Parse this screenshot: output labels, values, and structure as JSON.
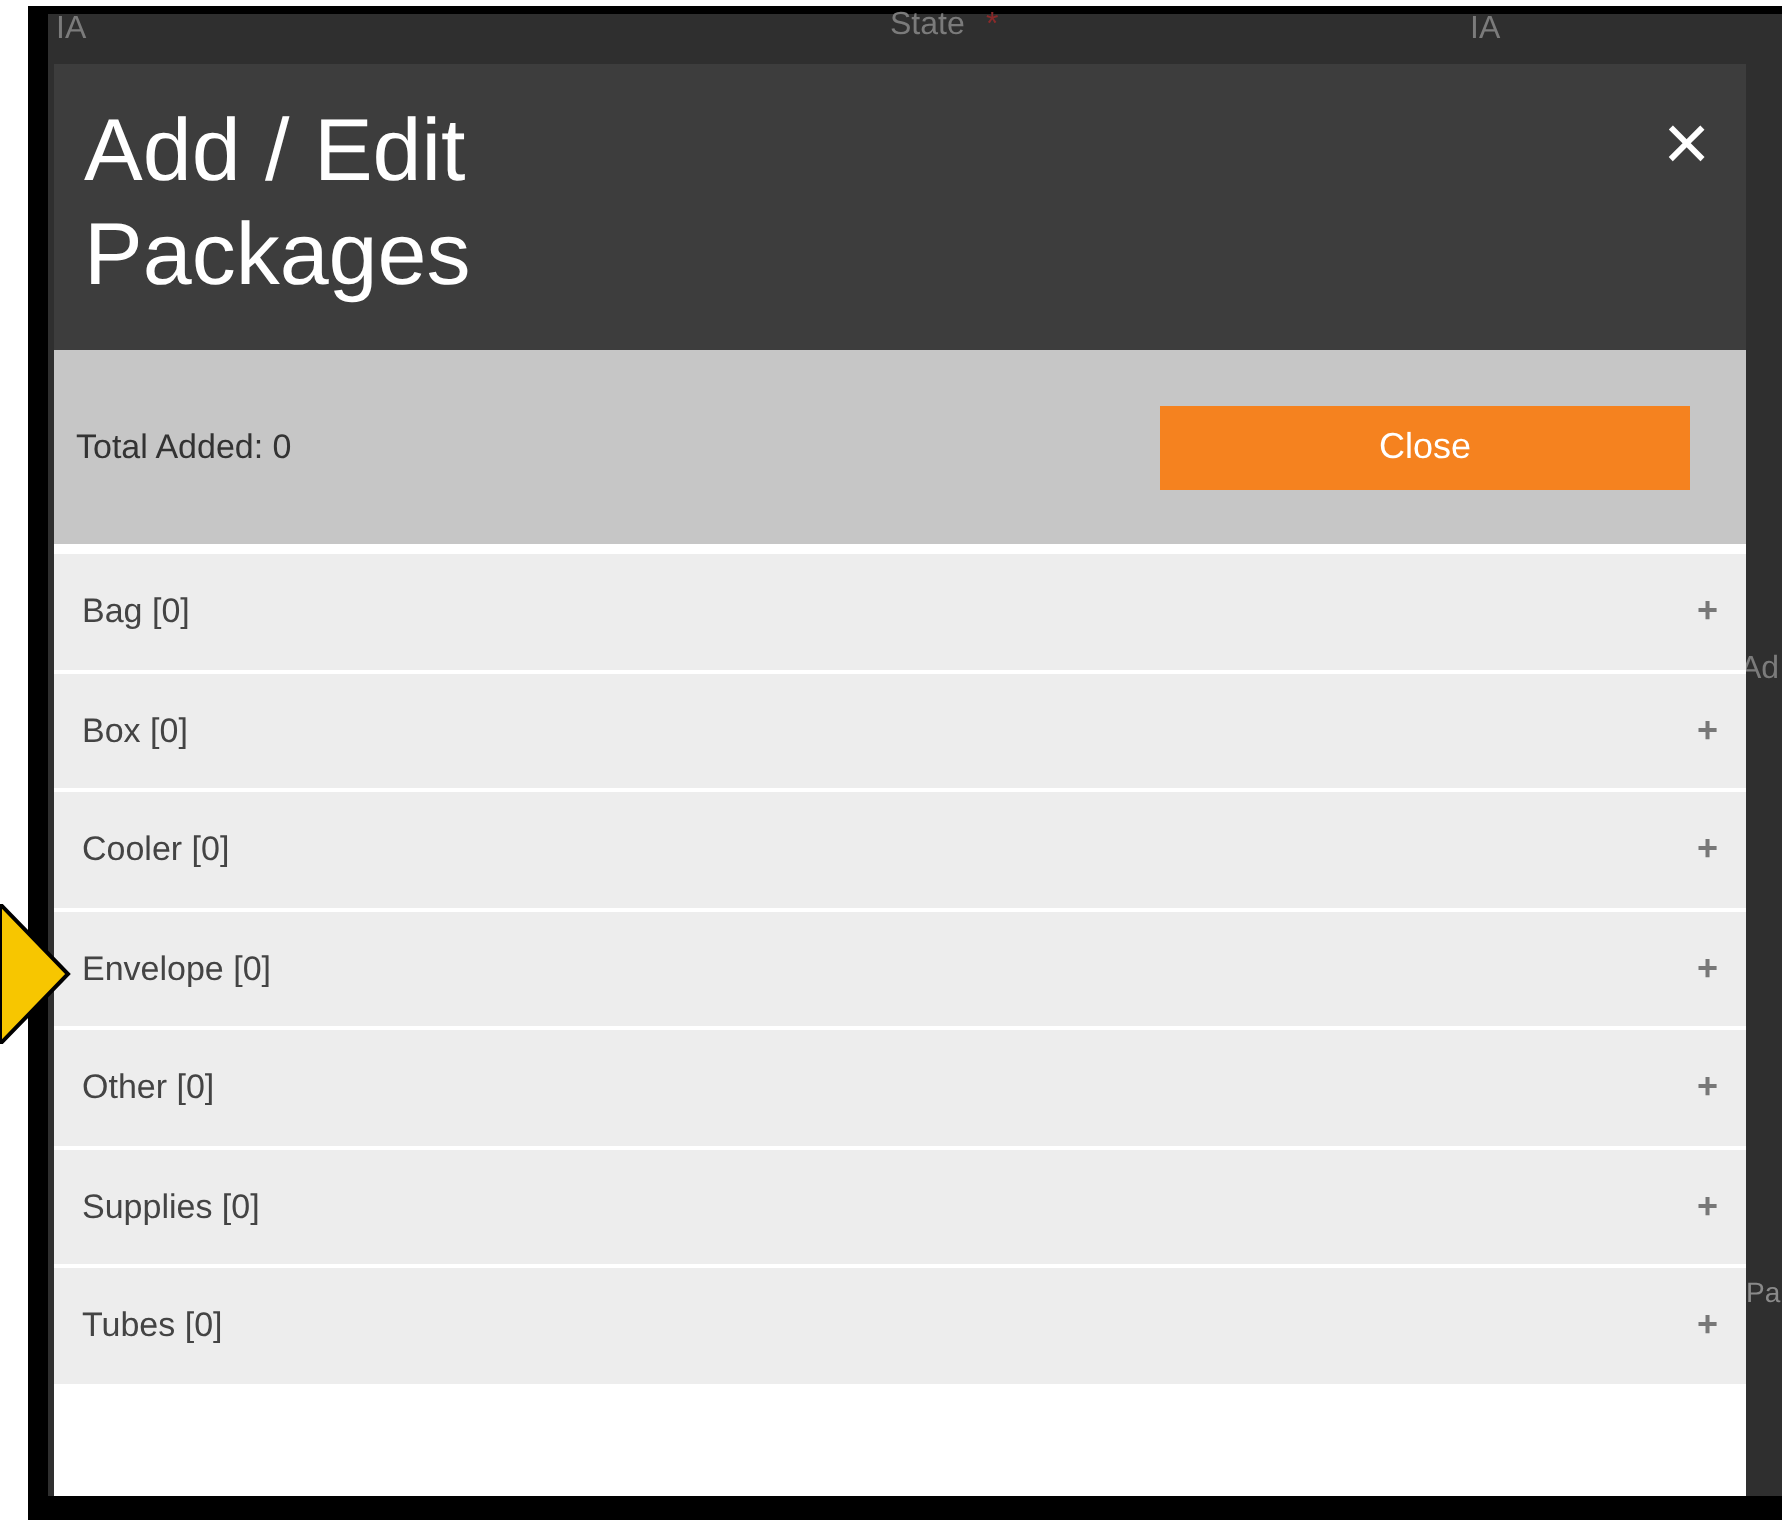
{
  "background_page": {
    "texts": [
      {
        "text": "IA"
      },
      {
        "text": "State",
        "required_mark": "*"
      },
      {
        "text": "IA"
      },
      {
        "text": "Ad"
      },
      {
        "text": "Pa"
      }
    ]
  },
  "dialog": {
    "title": "Add / Edit Packages",
    "close_icon": "×",
    "total_label": "Total Added: 0",
    "close_button": "Close",
    "package_types": [
      {
        "label": "Bag [0]",
        "expand": "+"
      },
      {
        "label": "Box [0]",
        "expand": "+"
      },
      {
        "label": "Cooler [0]",
        "expand": "+"
      },
      {
        "label": "Envelope [0]",
        "expand": "+"
      },
      {
        "label": "Other [0]",
        "expand": "+"
      },
      {
        "label": "Supplies [0]",
        "expand": "+"
      },
      {
        "label": "Tubes [0]",
        "expand": "+"
      }
    ]
  }
}
